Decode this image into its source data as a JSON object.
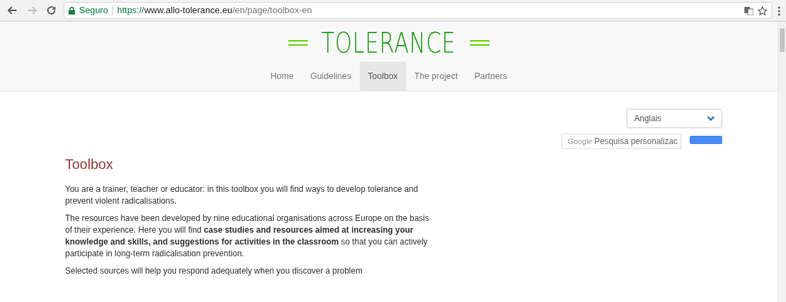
{
  "browser": {
    "security_label": "Seguro",
    "url": {
      "scheme": "https://",
      "host": "www.allo-tolerance.eu",
      "path": "/en/page/toolbox-en"
    }
  },
  "site": {
    "logo": "TOLERANCE"
  },
  "nav": [
    {
      "label": "Home",
      "selected": false
    },
    {
      "label": "Guidelines",
      "selected": false
    },
    {
      "label": "Toolbox",
      "selected": true
    },
    {
      "label": "The project",
      "selected": false
    },
    {
      "label": "Partners",
      "selected": false
    }
  ],
  "language_select": {
    "value": "Anglais"
  },
  "search": {
    "brand": "Google",
    "placeholder": "Pesquisa personalizac"
  },
  "page": {
    "title": "Toolbox",
    "paragraphs": [
      "You are a trainer, teacher or educator: in this toolbox you will find ways to develop tolerance and prevent violent radicalisations.",
      "The resources have been developed by nine educational organisations across Europe on the basis of their experience. Here you will find **case studies and resources aimed at increasing your knowledge and skills, and suggestions for activities in the classroom** so that you can actively participate in long-term radicalisation prevention.",
      "Selected sources will help you respond adequately when you discover a problem"
    ]
  }
}
